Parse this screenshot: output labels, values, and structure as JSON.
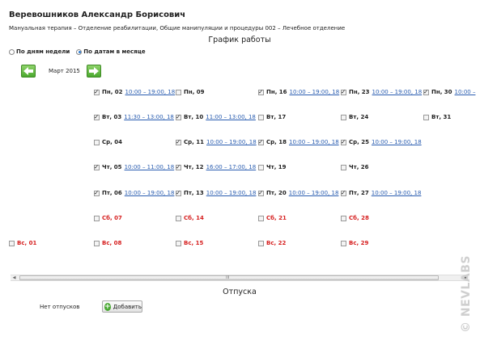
{
  "doctor": {
    "name": "Веревошников Александр Борисович",
    "subtitle": "Мануальная терапия – Отделение реабилитации, Общие манипуляции и процедуры 002 – Лечебное отделение"
  },
  "schedule": {
    "title": "График работы",
    "mode_options": [
      {
        "label": "По дням недели",
        "selected": false
      },
      {
        "label": "По датам в месяце",
        "selected": true
      }
    ],
    "month_label": "Март 2015",
    "prev_icon": "arrow-left-icon",
    "next_icon": "arrow-right-icon",
    "days": [
      {
        "label": "Вс, 01",
        "checked": false,
        "time": "",
        "weekend": true
      },
      {
        "label": "Пн, 02",
        "checked": true,
        "time": "10:00 – 19:00, 18",
        "weekend": false
      },
      {
        "label": "Вт, 03",
        "checked": true,
        "time": "11:30 – 13:00, 18",
        "weekend": false
      },
      {
        "label": "Ср, 04",
        "checked": false,
        "time": "",
        "weekend": false
      },
      {
        "label": "Чт, 05",
        "checked": true,
        "time": "10:00 – 11:00, 18",
        "weekend": false
      },
      {
        "label": "Пт, 06",
        "checked": true,
        "time": "10:00 – 19:00, 18",
        "weekend": false
      },
      {
        "label": "Сб, 07",
        "checked": false,
        "time": "",
        "weekend": true
      },
      {
        "label": "Вс, 08",
        "checked": false,
        "time": "",
        "weekend": true
      },
      {
        "label": "Пн, 09",
        "checked": false,
        "time": "",
        "weekend": false
      },
      {
        "label": "Вт, 10",
        "checked": true,
        "time": "11:00 – 13:00, 18",
        "weekend": false
      },
      {
        "label": "Ср, 11",
        "checked": true,
        "time": "10:00 – 19:00, 18",
        "weekend": false
      },
      {
        "label": "Чт, 12",
        "checked": true,
        "time": "16:00 – 17:00, 18",
        "weekend": false
      },
      {
        "label": "Пт, 13",
        "checked": true,
        "time": "10:00 – 19:00, 18",
        "weekend": false
      },
      {
        "label": "Сб, 14",
        "checked": false,
        "time": "",
        "weekend": true
      },
      {
        "label": "Вс, 15",
        "checked": false,
        "time": "",
        "weekend": true
      },
      {
        "label": "Пн, 16",
        "checked": true,
        "time": "10:00 – 19:00, 18",
        "weekend": false
      },
      {
        "label": "Вт, 17",
        "checked": false,
        "time": "",
        "weekend": false
      },
      {
        "label": "Ср, 18",
        "checked": true,
        "time": "10:00 – 19:00, 18",
        "weekend": false
      },
      {
        "label": "Чт, 19",
        "checked": false,
        "time": "",
        "weekend": false
      },
      {
        "label": "Пт, 20",
        "checked": true,
        "time": "10:00 – 19:00, 18",
        "weekend": false
      },
      {
        "label": "Сб, 21",
        "checked": false,
        "time": "",
        "weekend": true
      },
      {
        "label": "Вс, 22",
        "checked": false,
        "time": "",
        "weekend": true
      },
      {
        "label": "Пн, 23",
        "checked": true,
        "time": "10:00 – 19:00, 18",
        "weekend": false
      },
      {
        "label": "Вт, 24",
        "checked": false,
        "time": "",
        "weekend": false
      },
      {
        "label": "Ср, 25",
        "checked": true,
        "time": "10:00 – 19:00, 18",
        "weekend": false
      },
      {
        "label": "Чт, 26",
        "checked": false,
        "time": "",
        "weekend": false
      },
      {
        "label": "Пт, 27",
        "checked": true,
        "time": "10:00 – 19:00, 18",
        "weekend": false
      },
      {
        "label": "Сб, 28",
        "checked": false,
        "time": "",
        "weekend": true
      },
      {
        "label": "Вс, 29",
        "checked": false,
        "time": "",
        "weekend": true
      },
      {
        "label": "Пн, 30",
        "checked": true,
        "time": "10:00 –",
        "weekend": false
      },
      {
        "label": "Вт, 31",
        "checked": false,
        "time": "",
        "weekend": false
      }
    ]
  },
  "scrollbar": {
    "left_arrow": "◀",
    "right_arrow": "▶",
    "grip": "III"
  },
  "vacations": {
    "title": "Отпуска",
    "empty_text": "Нет отпусков",
    "add_button_label": "Добавить",
    "add_icon": "plus-circle-icon"
  },
  "watermark": "© NEVLABS",
  "colors": {
    "accent_green": "#4aa82e",
    "link_blue": "#2a5db0",
    "weekend_red": "#d62020"
  }
}
